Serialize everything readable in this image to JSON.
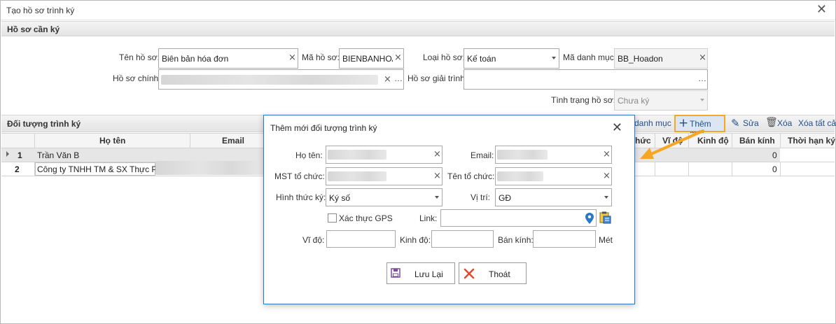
{
  "window": {
    "title": "Tạo hồ sơ trình ký"
  },
  "section_profile": {
    "header": "Hồ sơ cần ký",
    "ten_ho_so": {
      "label": "Tên hồ sơ:",
      "value": "Biên bản hóa đơn"
    },
    "ma_ho_so": {
      "label": "Mã hồ sơ:",
      "value": "BIENBANHOAD"
    },
    "loai_ho_so": {
      "label": "Loại hồ sơ:",
      "value": "Kế toán"
    },
    "ma_danh_muc": {
      "label": "Mã danh mục:",
      "value": "BB_Hoadon"
    },
    "ho_so_chinh": {
      "label": "Hồ sơ chính:"
    },
    "ho_so_giai_trinh": {
      "label": "Hồ sơ giải trình:"
    },
    "tinh_trang": {
      "label": "Tình trạng hồ sơ:",
      "value": "Chưa ký"
    }
  },
  "section_signers": {
    "header": "Đối tượng trình ký",
    "toolbar": {
      "danh_muc": "danh mục",
      "them_moi": "Thêm mới",
      "sua": "Sửa",
      "xoa": "Xóa",
      "xoa_tat_ca": "Xóa tất cả"
    },
    "columns": {
      "ho_ten": "Họ tên",
      "email": "Email",
      "hinh_thuc_partial": "hức",
      "vi_do": "Vĩ độ",
      "kinh_do": "Kinh độ",
      "ban_kinh": "Bán kính",
      "thoi_han_ky": "Thời hạn ký"
    },
    "rows": [
      {
        "stt": "1",
        "ho_ten": "Trần Văn B",
        "ban_kinh": "0"
      },
      {
        "stt": "2",
        "ho_ten": "Công ty TNHH TM & SX Thực Phẩm",
        "ban_kinh": "0"
      }
    ]
  },
  "dialog": {
    "title": "Thêm mới đối tượng trình ký",
    "ho_ten_label": "Họ tên:",
    "email_label": "Email:",
    "mst_label": "MST tổ chức:",
    "ten_to_chuc_label": "Tên tổ chức:",
    "hinh_thuc_ky_label": "Hình thức ký:",
    "hinh_thuc_ky_value": "Ký số",
    "vi_tri_label": "Vị trí:",
    "vi_tri_value": "GĐ",
    "gps_label": "Xác thực GPS",
    "link_label": "Link:",
    "vi_do_label": "Vĩ độ:",
    "kinh_do_label": "Kinh độ:",
    "ban_kinh_label": "Bán kính:",
    "met_label": "Mét",
    "save_label": "Lưu Lại",
    "exit_label": "Thoát"
  },
  "colors": {
    "accent": "#2b78c5",
    "highlight": "#f5a623",
    "link": "#1f4e8c"
  }
}
